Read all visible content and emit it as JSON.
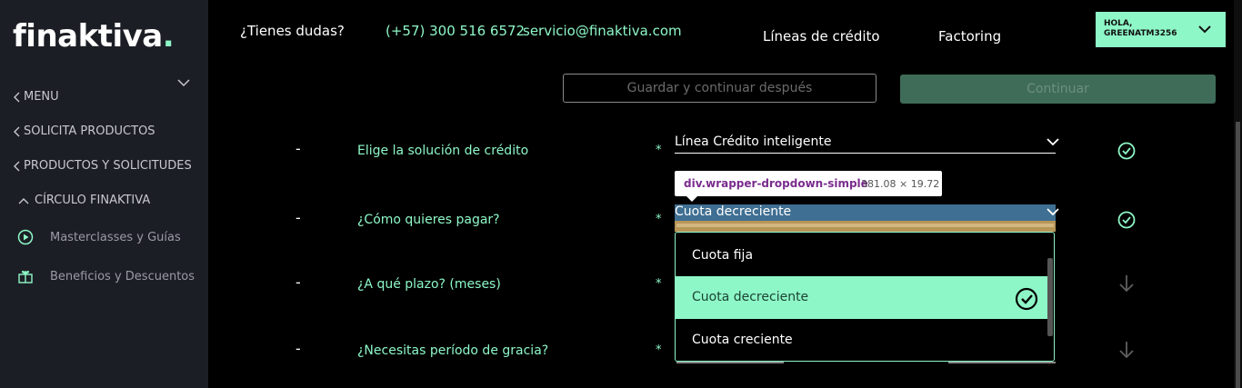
{
  "brand": {
    "logo_text": "finaktiva",
    "logo_dot": ".",
    "accent": "#8ef7c7"
  },
  "sidebar": {
    "items": [
      {
        "label": "MENU"
      },
      {
        "label": "SOLICITA PRODUCTOS"
      },
      {
        "label": "PRODUCTOS Y SOLICITUDES"
      }
    ],
    "group": {
      "label": "CÍRCULO FINAKTIVA"
    },
    "subitems": [
      {
        "label": "Masterclasses y Guías",
        "icon": "play-circle-icon"
      },
      {
        "label": "Beneficios y Descuentos",
        "icon": "gift-icon"
      }
    ]
  },
  "header": {
    "question": "¿Tienes dudas?",
    "phone": "(+57) 300 516 6572",
    "email": "servicio@finaktiva.com",
    "nav": [
      {
        "label": "Líneas de crédito"
      },
      {
        "label": "Factoring"
      }
    ],
    "user": {
      "greeting": "HOLA,",
      "username": "GREENATM3256"
    }
  },
  "actions": {
    "save_label": "Guardar y continuar después",
    "continue_label": "Continuar"
  },
  "form": {
    "rows": [
      {
        "dash": "-",
        "question": "Elige la solución de crédito",
        "required": "*",
        "value": "Línea Crédito inteligente",
        "status": "check"
      },
      {
        "dash": "-",
        "question": "¿Cómo quieres pagar?",
        "required": "*",
        "value": "Cuota decreciente",
        "status": "check"
      },
      {
        "dash": "-",
        "question": "¿A qué plazo? (meses)",
        "required": "*",
        "status": "pending"
      },
      {
        "dash": "-",
        "question": "¿Necesitas período de gracia?",
        "required": "*",
        "status": "pending"
      }
    ]
  },
  "devtools_tooltip": {
    "selector": "div.wrapper-dropdown-simple",
    "dimensions": "381.08 × 19.72"
  },
  "dropdown": {
    "options": [
      {
        "label": "Cuota fija"
      },
      {
        "label": "Cuota decreciente",
        "selected": true
      },
      {
        "label": "Cuota creciente"
      }
    ]
  }
}
